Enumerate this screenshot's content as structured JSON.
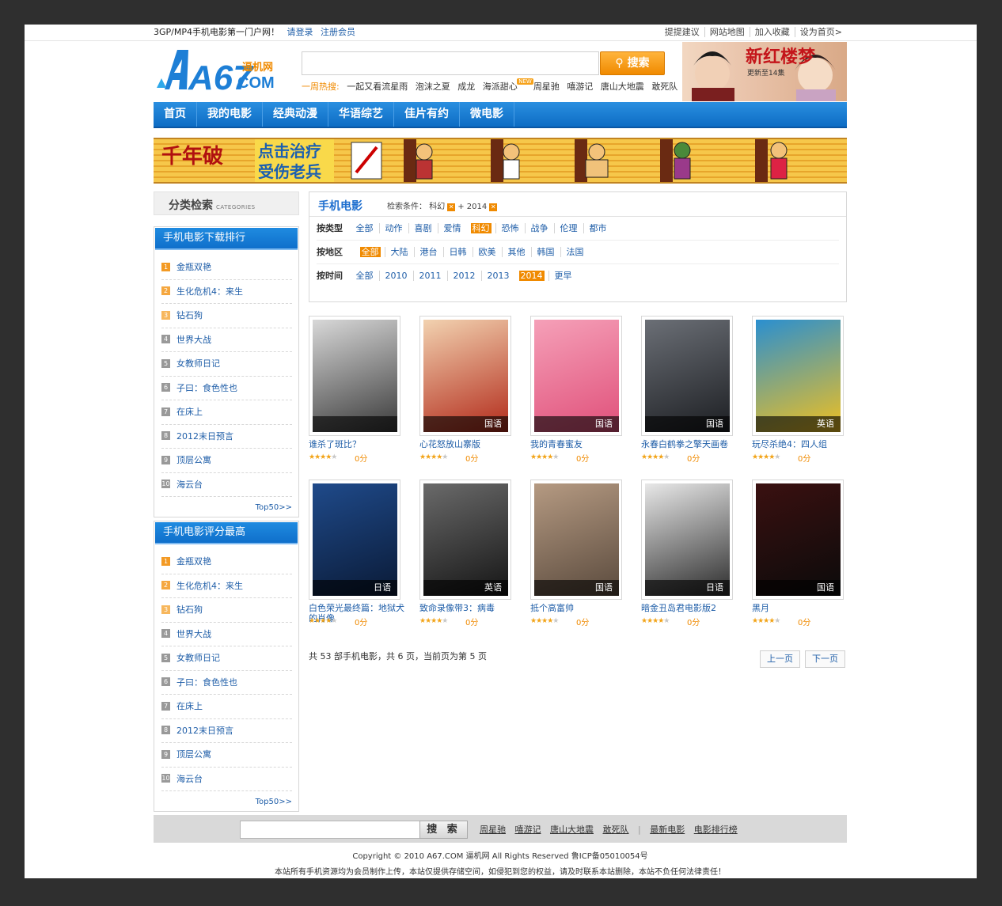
{
  "topbar": {
    "slogan": "3GP/MP4手机电影第一门户网！",
    "login": "请登录",
    "register": "注册会员",
    "links": [
      "提提建议",
      "网站地图",
      "加入收藏",
      "设为首页>"
    ]
  },
  "header": {
    "logo_main": "A67",
    "logo_sub": "COM",
    "logo_cn": "逼机网",
    "search_placeholder": "",
    "search_button": "搜索",
    "hot_label": "一周热搜:",
    "hot_keywords": [
      "一起又看流星雨",
      "泡沫之夏",
      "成龙",
      "海派甜心",
      "周星驰",
      "嘻游记",
      "唐山大地震",
      "敢死队"
    ],
    "new_badge": "NEW",
    "promo_title": "新红楼梦",
    "promo_sub": "更新至14集"
  },
  "nav": [
    "首页",
    "我的电影",
    "经典动漫",
    "华语综艺",
    "佳片有约",
    "微电影"
  ],
  "banner": {
    "text1": "千年破",
    "text2": "点击治疗",
    "text3": "受伤老兵"
  },
  "sidebar": {
    "category_title": "分类检索",
    "category_sub": "CATEGORIES",
    "download_rank": {
      "title": "手机电影下载排行",
      "items": [
        "金瓶双艳",
        "生化危机4：来生",
        "钻石狗",
        "世界大战",
        "女教师日记",
        "子曰：食色性也",
        "在床上",
        "2012末日预言",
        "顶层公寓",
        "海云台"
      ],
      "more": "Top50>>"
    },
    "score_rank": {
      "title": "手机电影评分最高",
      "items": [
        "金瓶双艳",
        "生化危机4：来生",
        "钻石狗",
        "世界大战",
        "女教师日记",
        "子曰：食色性也",
        "在床上",
        "2012末日预言",
        "顶层公寓",
        "海云台"
      ],
      "more": "Top50>>"
    }
  },
  "filter": {
    "title": "手机电影",
    "cond_label": "检索条件：",
    "cond1": "科幻",
    "plus": "+",
    "cond2": "2014",
    "type_label": "按类型",
    "types": [
      "全部",
      "动作",
      "喜剧",
      "爱情",
      "科幻",
      "恐怖",
      "战争",
      "伦理",
      "都市"
    ],
    "type_selected": 4,
    "area_label": "按地区",
    "areas": [
      "全部",
      "大陆",
      "港台",
      "日韩",
      "欧美",
      "其他",
      "韩国",
      "法国"
    ],
    "area_selected": 0,
    "time_label": "按时间",
    "times": [
      "全部",
      "2010",
      "2011",
      "2012",
      "2013",
      "2014",
      "更早"
    ],
    "time_selected": 5
  },
  "movies": [
    {
      "name": "谁杀了斑比？",
      "lang": "",
      "stars": 4,
      "score": "0分",
      "c1": "#d8d8d8",
      "c2": "#3a3a3a"
    },
    {
      "name": "心花怒放山寨版",
      "lang": "国语",
      "stars": 4,
      "score": "0分",
      "c1": "#f2d2b0",
      "c2": "#b22a1a"
    },
    {
      "name": "我的青春蜜友",
      "lang": "国语",
      "stars": 4,
      "score": "0分",
      "c1": "#f5a0b8",
      "c2": "#e0507a"
    },
    {
      "name": "永春白鹤拳之擎天画卷",
      "lang": "国语",
      "stars": 4,
      "score": "0分",
      "c1": "#6b6f76",
      "c2": "#1c1e22"
    },
    {
      "name": "玩尽杀绝4：四人组",
      "lang": "英语",
      "stars": 4,
      "score": "0分",
      "c1": "#2a8fd0",
      "c2": "#f0c020"
    },
    {
      "name": "白色荣光最终篇：地狱犬的肖像",
      "lang": "日语",
      "stars": 4,
      "score": "0分",
      "c1": "#1f4a8a",
      "c2": "#0a1a36"
    },
    {
      "name": "致命录像带3：病毒",
      "lang": "英语",
      "stars": 4,
      "score": "0分",
      "c1": "#6a6a6a",
      "c2": "#151515"
    },
    {
      "name": "抵个高富帅",
      "lang": "国语",
      "stars": 4,
      "score": "0分",
      "c1": "#b59a82",
      "c2": "#5a4a3d"
    },
    {
      "name": "暗金丑岛君电影版2",
      "lang": "日语",
      "stars": 4,
      "score": "0分",
      "c1": "#e8e8e8",
      "c2": "#2c2c2c"
    },
    {
      "name": "黑月",
      "lang": "国语",
      "stars": 4,
      "score": "0分",
      "c1": "#3a1010",
      "c2": "#0b0b0b"
    }
  ],
  "pagination": {
    "info": "共 53 部手机电影，共 6 页，当前页为第 5 页",
    "prev": "上一页",
    "next": "下一页"
  },
  "footer": {
    "search_button": "搜 索",
    "links": [
      "周星驰",
      "嘻游记",
      "唐山大地震",
      "敢死队"
    ],
    "sep": "|",
    "links2": [
      "最新电影",
      "电影排行榜"
    ],
    "copyright": "Copyright © 2010 A67.COM 逼机网 All Rights Reserved 鲁ICP备05010054号",
    "disclaimer": "本站所有手机资源均为会员制作上传，本站仅提供存储空间，如侵犯到您的权益，请及时联系本站删除，本站不负任何法律责任！"
  }
}
